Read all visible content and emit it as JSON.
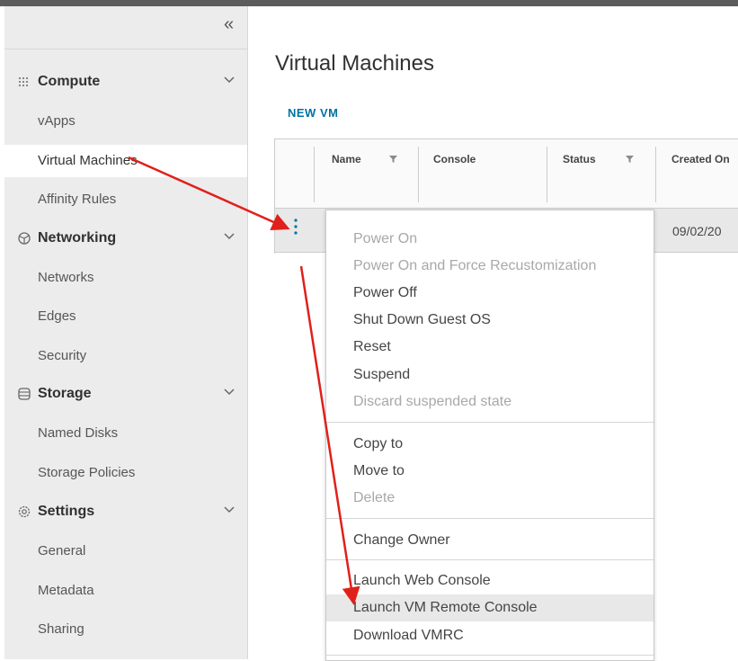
{
  "sidebar": {
    "collapse_icon": "double-chevron-left-icon",
    "sections": [
      {
        "label": "Compute",
        "icon": "grid-dots-icon",
        "items": [
          {
            "label": "vApps"
          },
          {
            "label": "Virtual Machines",
            "active": true
          },
          {
            "label": "Affinity Rules"
          }
        ]
      },
      {
        "label": "Networking",
        "icon": "network-icon",
        "items": [
          {
            "label": "Networks"
          },
          {
            "label": "Edges"
          },
          {
            "label": "Security"
          }
        ]
      },
      {
        "label": "Storage",
        "icon": "database-icon",
        "items": [
          {
            "label": "Named Disks"
          },
          {
            "label": "Storage Policies"
          }
        ]
      },
      {
        "label": "Settings",
        "icon": "gear-icon",
        "items": [
          {
            "label": "General"
          },
          {
            "label": "Metadata"
          },
          {
            "label": "Sharing"
          }
        ]
      }
    ]
  },
  "main": {
    "title": "Virtual Machines",
    "new_vm_label": "NEW VM",
    "grid": {
      "columns": [
        "Name",
        "Console",
        "Status",
        "Created On"
      ],
      "row": {
        "created_on": "09/02/20"
      }
    }
  },
  "context_menu": {
    "groups": [
      [
        {
          "label": "Power On",
          "disabled": true
        },
        {
          "label": "Power On and Force Recustomization",
          "disabled": true
        },
        {
          "label": "Power Off",
          "disabled": false
        },
        {
          "label": "Shut Down Guest OS",
          "disabled": false
        },
        {
          "label": "Reset",
          "disabled": false
        },
        {
          "label": "Suspend",
          "disabled": false
        },
        {
          "label": "Discard suspended state",
          "disabled": true
        }
      ],
      [
        {
          "label": "Copy to",
          "disabled": false
        },
        {
          "label": "Move to",
          "disabled": false
        },
        {
          "label": "Delete",
          "disabled": true
        }
      ],
      [
        {
          "label": "Change Owner",
          "disabled": false
        }
      ],
      [
        {
          "label": "Launch Web Console",
          "disabled": false
        },
        {
          "label": "Launch VM Remote Console",
          "disabled": false,
          "highlighted": true
        },
        {
          "label": "Download VMRC",
          "disabled": false
        }
      ]
    ]
  },
  "colors": {
    "accent": "#0072a3",
    "annotation_arrow": "#e0201b",
    "sidebar_bg": "#ececec",
    "disabled_text": "#a8a8a8"
  }
}
